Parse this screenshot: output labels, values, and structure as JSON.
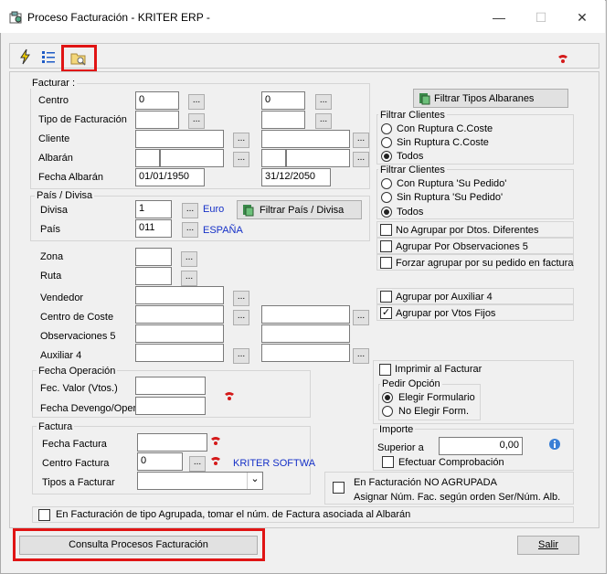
{
  "window": {
    "title": "Proceso Facturación - KRITER ERP -",
    "minimize": "—",
    "maximize": "☐",
    "close": "✕"
  },
  "toolbar": {
    "icons": [
      "lightning-icon",
      "list-icon",
      "folder-search-icon"
    ],
    "help_icon": "help-icon"
  },
  "facturar": {
    "title": "Facturar :",
    "centro_label": "Centro",
    "centro_from": "0",
    "centro_to": "0",
    "tipo_label": "Tipo de Facturación",
    "cliente_label": "Cliente",
    "albaran_label": "Albarán",
    "fecha_albaran_label": "Fecha Albarán",
    "fecha_from": "01/01/1950",
    "fecha_to": "31/12/2050",
    "dots": "...",
    "filtrar_tipos_btn": "Filtrar Tipos Albaranes"
  },
  "pais_divisa": {
    "title": "País / Divisa",
    "divisa_label": "Divisa",
    "divisa_value": "1",
    "divisa_name": "Euro",
    "pais_label": "País",
    "pais_value": "011",
    "pais_name": "ESPAÑA",
    "filtrar_btn": "Filtrar País / Divisa"
  },
  "filtrar_clientes_1": {
    "title": "Filtrar Clientes",
    "options": [
      "Con Ruptura C.Coste",
      "Sin Ruptura C.Coste",
      "Todos"
    ],
    "selected": 2
  },
  "filtrar_clientes_2": {
    "title": "Filtrar Clientes",
    "options": [
      "Con Ruptura 'Su Pedido'",
      "Sin Ruptura 'Su Pedido'",
      "Todos"
    ],
    "selected": 2
  },
  "checks_a": [
    "No Agrupar por Dtos. Diferentes",
    "Agrupar Por Observaciones 5",
    "Forzar agrupar por su pedido en factura"
  ],
  "other": {
    "zona_label": "Zona",
    "ruta_label": "Ruta",
    "vendedor_label": "Vendedor",
    "centro_coste_label": "Centro de Coste",
    "obs5_label": "Observaciones 5",
    "aux4_label": "Auxiliar 4"
  },
  "checks_b": {
    "aux4": "Agrupar por Auxiliar 4",
    "vtos": "Agrupar por Vtos Fijos",
    "vtos_checked": "✓"
  },
  "fecha_operacion": {
    "title": "Fecha Operación",
    "valor_label": "Fec. Valor (Vtos.)",
    "devengo_label": "Fecha Devengo/Oper"
  },
  "imprimir": {
    "label": "Imprimir al Facturar",
    "pedir_title": "Pedir Opción",
    "options": [
      "Elegir Formulario",
      "No Elegir Form."
    ],
    "selected": 0
  },
  "factura": {
    "title": "Factura",
    "fecha_label": "Fecha Factura",
    "centro_label": "Centro Factura",
    "centro_value": "0",
    "centro_name": "KRITER SOFTWA",
    "tipos_label": "Tipos a Facturar",
    "dropdown_icon": "⌄"
  },
  "importe": {
    "title": "Importe",
    "superior_label": "Superior a",
    "superior_value": "0,00",
    "efectuar_label": "Efectuar Comprobación"
  },
  "no_agrupada": {
    "line1": "En Facturación NO AGRUPADA",
    "line2": "Asignar Núm. Fac. según orden Ser/Núm. Alb."
  },
  "agrupada_label": "En Facturación de tipo Agrupada, tomar el núm. de Factura asociada al Albarán",
  "footer": {
    "consulta_btn": "Consulta Procesos Facturación",
    "salir_btn": "Salir"
  }
}
